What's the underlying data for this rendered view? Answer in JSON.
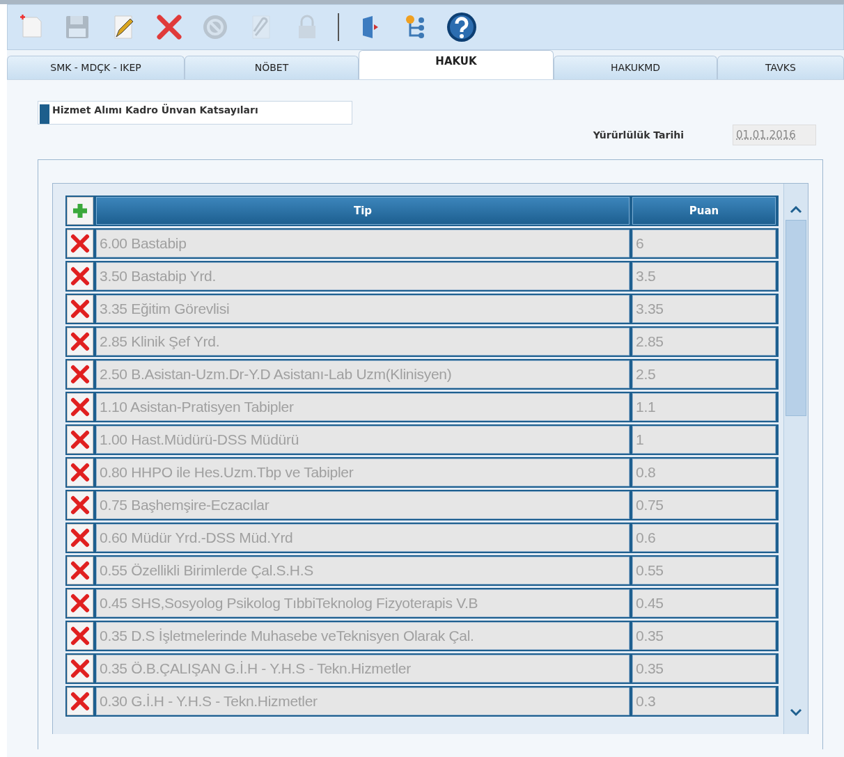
{
  "toolbar": [
    {
      "kind": "new",
      "disabled": false
    },
    {
      "kind": "save",
      "disabled": true
    },
    {
      "kind": "edit",
      "disabled": false
    },
    {
      "kind": "delete",
      "disabled": false
    },
    {
      "kind": "cancel",
      "disabled": true
    },
    {
      "kind": "attach",
      "disabled": true
    },
    {
      "kind": "lock",
      "disabled": true
    },
    {
      "kind": "separator"
    },
    {
      "kind": "exit",
      "disabled": false
    },
    {
      "kind": "tree",
      "disabled": false
    },
    {
      "kind": "help",
      "disabled": false
    }
  ],
  "tabs": [
    {
      "label": "SMK - MDÇK - IKEP",
      "selected": false
    },
    {
      "label": "NÖBET",
      "selected": false
    },
    {
      "label": "HAKUK",
      "selected": true
    },
    {
      "label": "HAKUKMD",
      "selected": false
    },
    {
      "label": "TAVKS",
      "selected": false
    }
  ],
  "section": {
    "title": "Hizmet Alımı Kadro Ünvan Katsayıları"
  },
  "effective_date": {
    "label": "Yürürlülük Tarihi",
    "value": "01.01.2016",
    "disabled": true
  },
  "table": {
    "columns": [
      "Tip",
      "Puan"
    ],
    "rows": [
      {
        "tip": "6.00 Bastabip",
        "puan": "6"
      },
      {
        "tip": "3.50 Bastabip Yrd.",
        "puan": "3.5"
      },
      {
        "tip": "3.35 Eğitim Görevlisi",
        "puan": "3.35"
      },
      {
        "tip": "2.85 Klinik Şef Yrd.",
        "puan": "2.85"
      },
      {
        "tip": "2.50 B.Asistan-Uzm.Dr-Y.D Asistanı-Lab Uzm(Klinisyen)",
        "puan": "2.5"
      },
      {
        "tip": "1.10 Asistan-Pratisyen Tabipler",
        "puan": "1.1"
      },
      {
        "tip": "1.00 Hast.Müdürü-DSS Müdürü",
        "puan": "1"
      },
      {
        "tip": "0.80 HHPO ile Hes.Uzm.Tbp ve Tabipler",
        "puan": "0.8"
      },
      {
        "tip": "0.75 Başhemşire-Eczacılar",
        "puan": "0.75"
      },
      {
        "tip": "0.60 Müdür Yrd.-DSS Müd.Yrd",
        "puan": "0.6"
      },
      {
        "tip": "0.55 Özellikli Birimlerde Çal.S.H.S",
        "puan": "0.55"
      },
      {
        "tip": "0.45 SHS,Sosyolog Psikolog TıbbiTeknolog Fizyoterapis V.B",
        "puan": "0.45"
      },
      {
        "tip": "0.35 D.S İşletmelerinde Muhasebe veTeknisyen Olarak Çal.",
        "puan": "0.35"
      },
      {
        "tip": "0.35 Ö.B.ÇALIŞAN G.İ.H - Y.H.S - Tekn.Hizmetler",
        "puan": "0.35"
      },
      {
        "tip": "0.30 G.İ.H - Y.H.S - Tekn.Hizmetler",
        "puan": "0.3"
      }
    ]
  }
}
